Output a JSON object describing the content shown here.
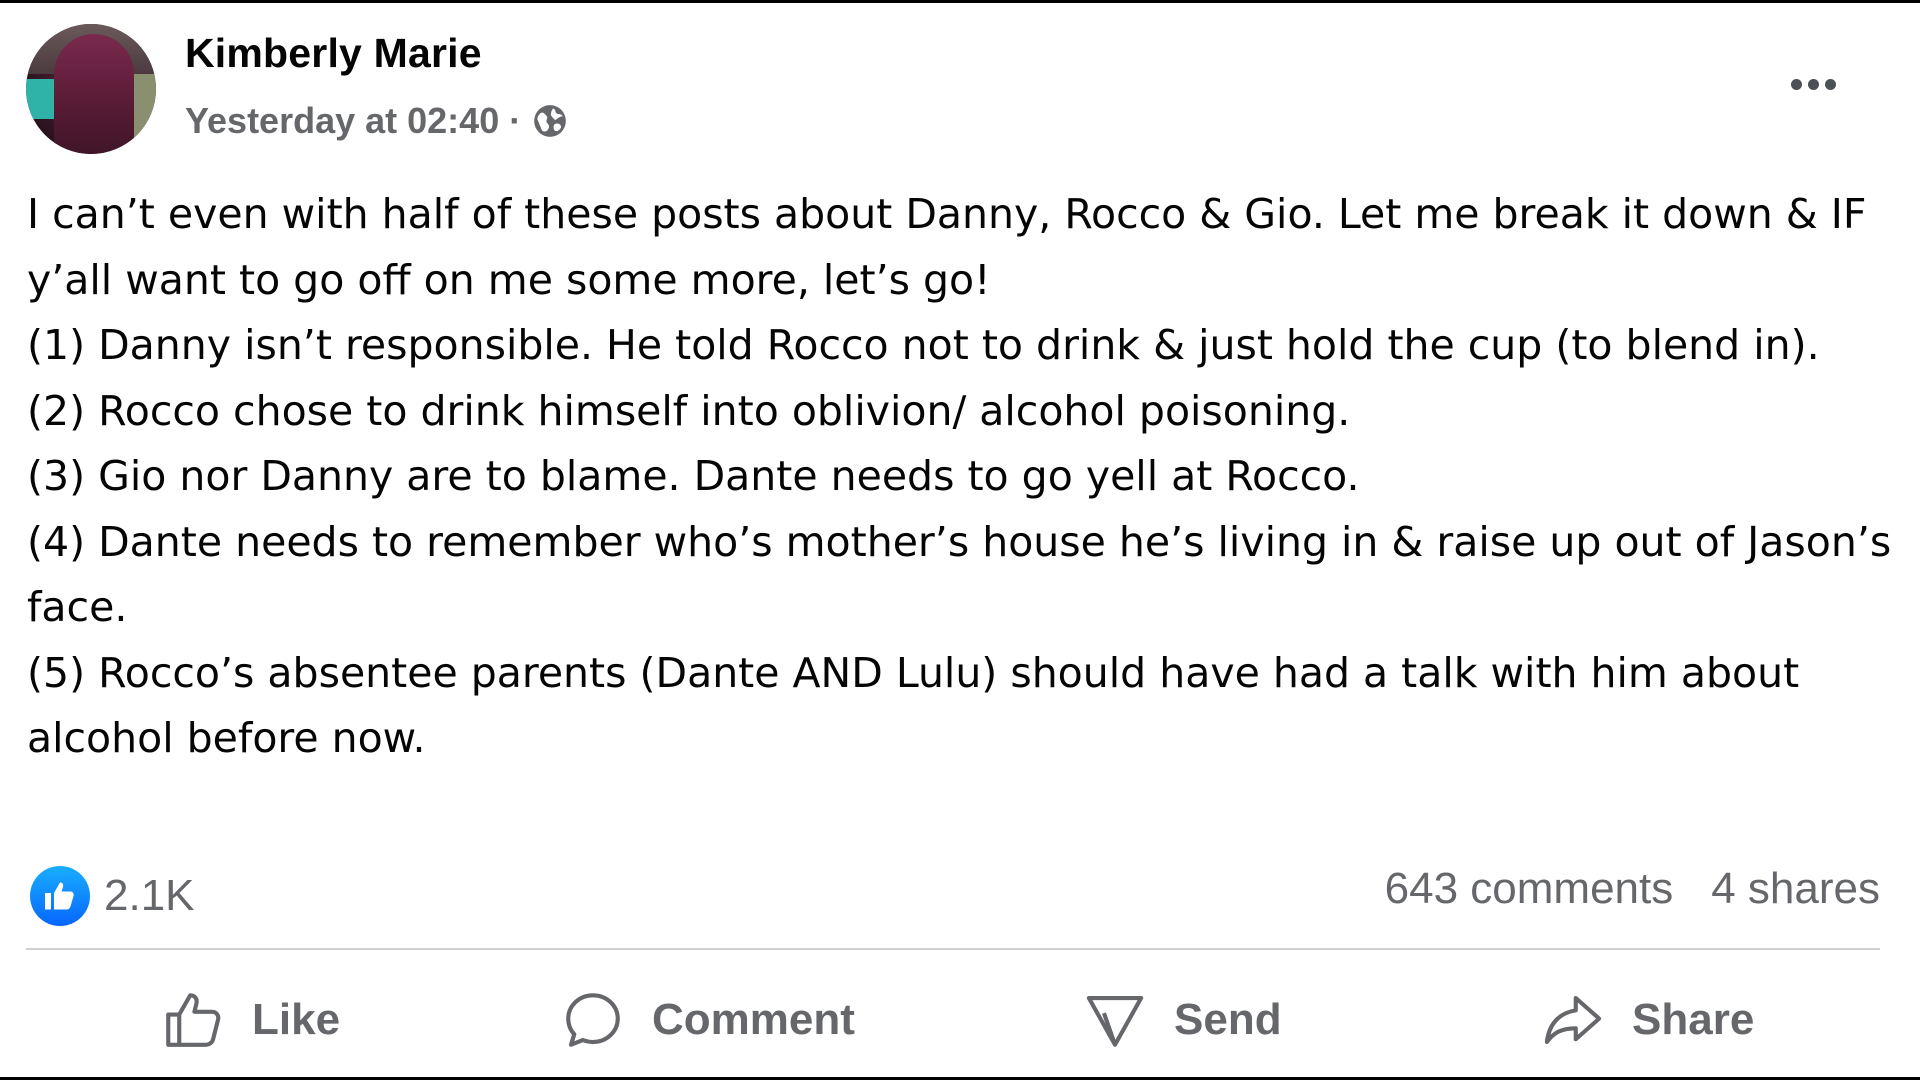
{
  "post": {
    "author": "Kimberly Marie",
    "timestamp": "Yesterday at 02:40",
    "separator": "·",
    "audience_icon": "globe-icon",
    "more_icon": "more-options-icon",
    "body_lines": [
      "I can’t even with half of these posts about Danny, Rocco & Gio. Let me break it down & IF y’all want to go off on me some more, let’s go!",
      "(1) Danny isn’t responsible. He told Rocco not to drink & just hold the cup (to blend in).",
      "(2) Rocco chose to drink himself into oblivion/ alcohol poisoning.",
      "(3) Gio nor Danny are to blame. Dante needs to go yell at Rocco.",
      "(4) Dante needs to remember who’s mother’s house he’s living in & raise up out of Jason’s face.",
      "(5) Rocco’s absentee parents (Dante AND Lulu) should have had a talk with him about alcohol before now."
    ]
  },
  "stats": {
    "reaction_icon": "like-reaction-icon",
    "reaction_count": "2.1K",
    "comments": "643 comments",
    "shares": "4 shares"
  },
  "actions": {
    "like_label": "Like",
    "comment_label": "Comment",
    "send_label": "Send",
    "share_label": "Share"
  },
  "colors": {
    "like_blue": "#0866ff",
    "secondary_text": "#65676b",
    "primary_text": "#050505",
    "divider": "#ced0d4"
  }
}
